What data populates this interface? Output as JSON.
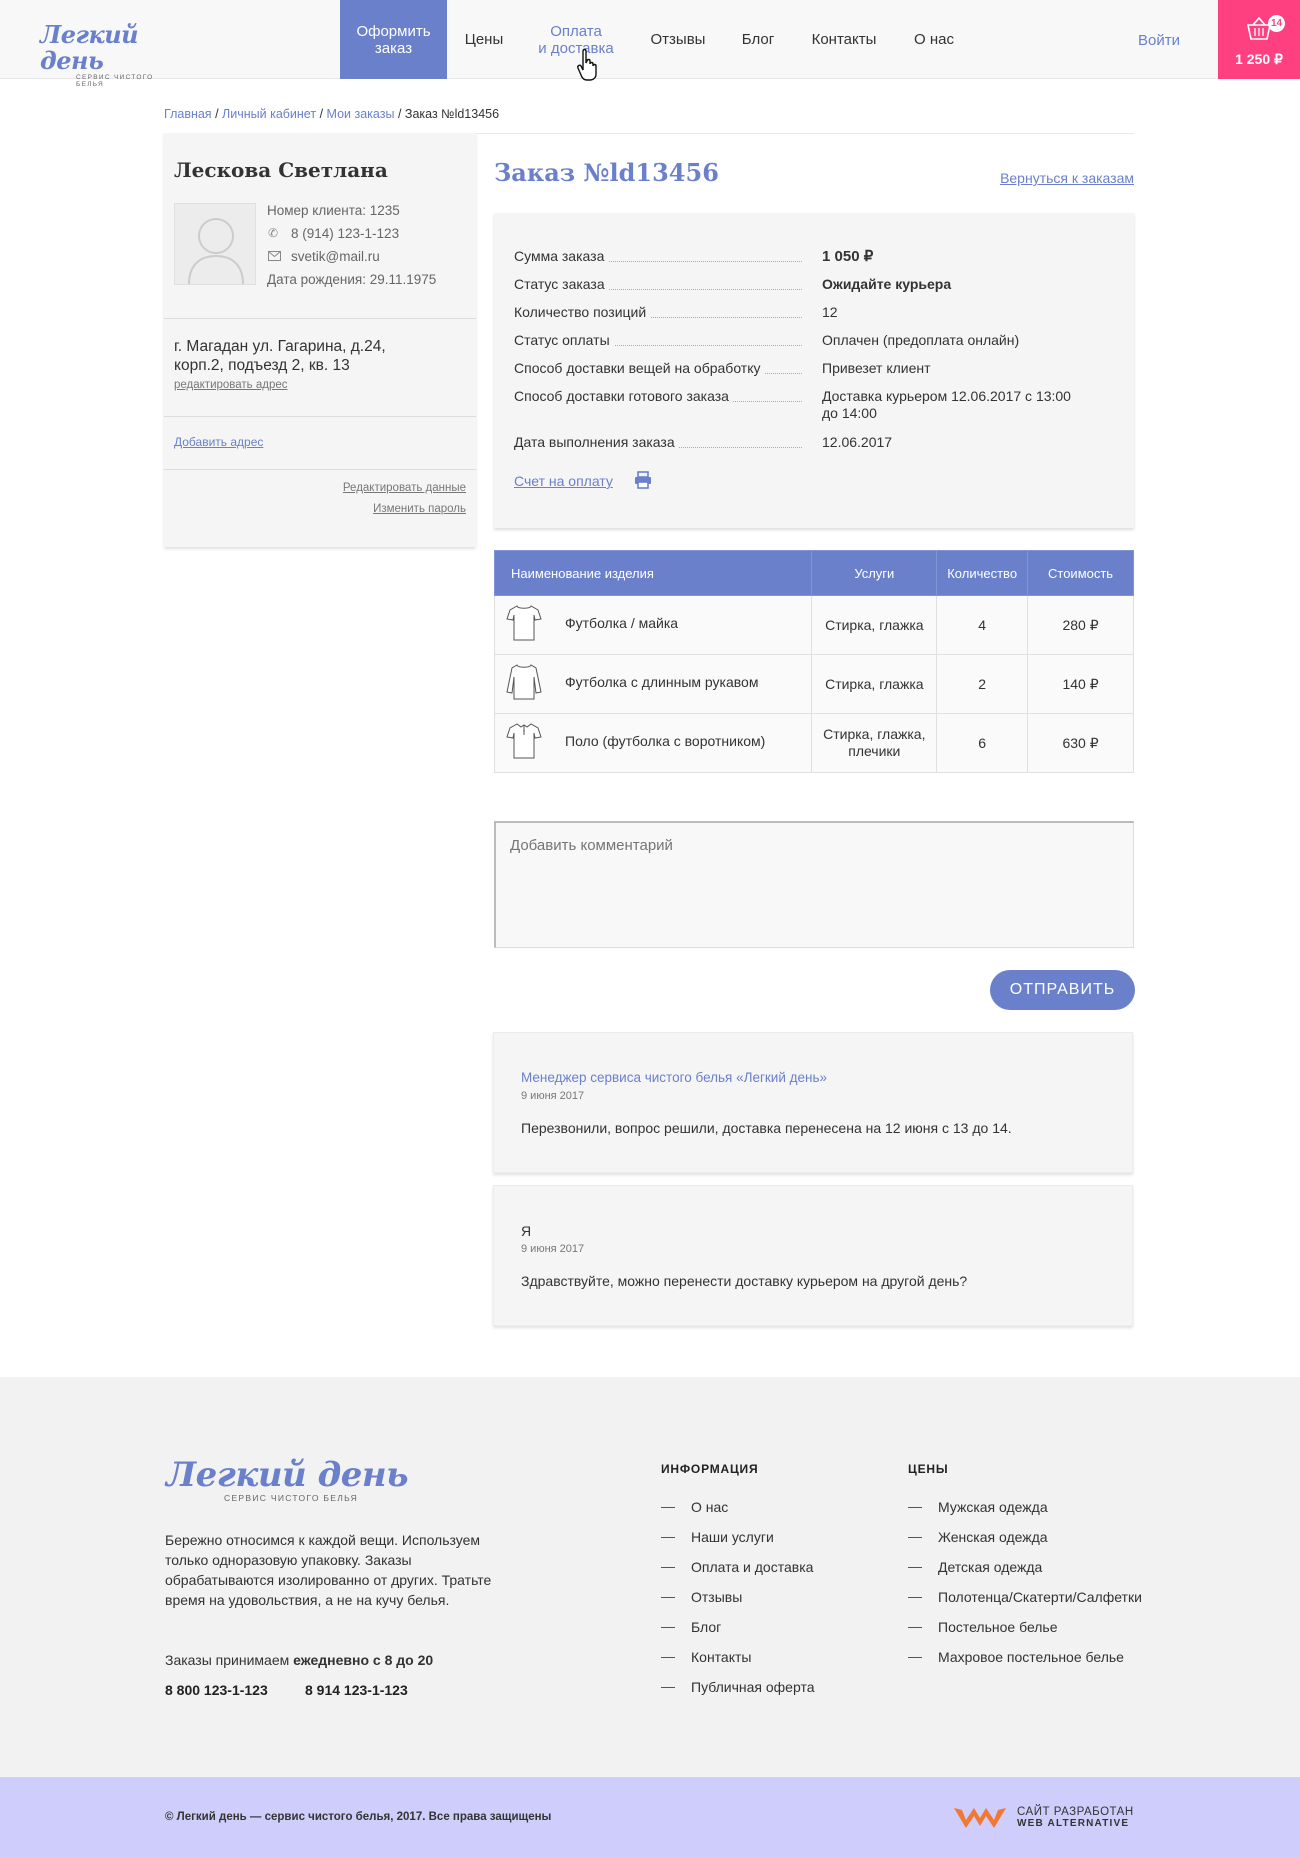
{
  "header": {
    "logo_title": "Легкий день",
    "logo_subtitle": "сервис чистого белья",
    "nav": [
      {
        "label_l1": "Оформить",
        "label_l2": "заказ"
      },
      {
        "label_l1": "Цены",
        "label_l2": ""
      },
      {
        "label_l1": "Оплата",
        "label_l2": "и доставка"
      },
      {
        "label_l1": "Отзывы",
        "label_l2": ""
      },
      {
        "label_l1": "Блог",
        "label_l2": ""
      },
      {
        "label_l1": "Контакты",
        "label_l2": ""
      },
      {
        "label_l1": "О нас",
        "label_l2": ""
      }
    ],
    "login": "Войти",
    "cart_count": "14",
    "cart_total": "1 250 ₽",
    "colors": {
      "accent": "#6a80cb",
      "cart": "#ff4080"
    }
  },
  "breadcrumb": {
    "home": "Главная",
    "cabinet": "Личный кабинет",
    "orders": "Мои заказы",
    "current": "Заказ №ld13456",
    "sep": "/"
  },
  "profile": {
    "name": "Лескова Светлана",
    "client_no": "Номер клиента: 1235",
    "phone": "8 (914) 123-1-123",
    "email": "svetik@mail.ru",
    "birthday": "Дата рождения: 29.11.1975",
    "address_l1": "г. Магадан ул. Гагарина, д.24,",
    "address_l2": "корп.2, подъезд 2, кв. 13",
    "edit_address": "редактировать адрес",
    "add_address": "Добавить адрес",
    "edit_data": "Редактировать данные",
    "change_password": "Изменить пароль"
  },
  "order": {
    "title": "Заказ №ld13456",
    "back_link": "Вернуться к заказам",
    "details": [
      {
        "label": "Сумма заказа",
        "value": "1 050 ₽",
        "value2": "",
        "bold": true
      },
      {
        "label": "Статус заказа",
        "value": "Ожидайте курьера",
        "value2": "",
        "bold": true
      },
      {
        "label": "Количество позиций",
        "value": "12",
        "value2": "",
        "bold": false
      },
      {
        "label": "Статус оплаты",
        "value": "Оплачен (предоплата онлайн)",
        "value2": "",
        "bold": false
      },
      {
        "label": "Способ доставки вещей на обработку",
        "value": "Привезет клиент",
        "value2": "",
        "bold": false
      },
      {
        "label": "Способ доставки готового заказа",
        "value": "Доставка курьером 12.06.2017 с 13:00",
        "value2": "до 14:00",
        "bold": false
      },
      {
        "label": "Дата выполнения заказа",
        "value": "12.06.2017",
        "value2": "",
        "bold": false
      }
    ],
    "invoice_link": "Счет на оплату"
  },
  "items_table": {
    "headers": [
      "Наименование изделия",
      "Услуги",
      "Количество",
      "Стоимость"
    ],
    "rows": [
      {
        "icon": "tshirt-icon",
        "name": "Футболка / майка",
        "services_l1": "Стирка, глажка",
        "services_l2": "",
        "qty": "4",
        "price": "280 ₽"
      },
      {
        "icon": "longsleeve-icon",
        "name": "Футболка с длинным рукавом",
        "services_l1": "Стирка, глажка",
        "services_l2": "",
        "qty": "2",
        "price": "140 ₽"
      },
      {
        "icon": "polo-icon",
        "name": "Поло (футболка с воротником)",
        "services_l1": "Стирка, глажка,",
        "services_l2": "плечики",
        "qty": "6",
        "price": "630 ₽"
      }
    ]
  },
  "comment": {
    "placeholder": "Добавить комментарий",
    "send": "ОТПРАВИТЬ"
  },
  "messages": [
    {
      "author": "Менеджер сервиса чистого белья «Легкий день»",
      "date": "9 июня 2017",
      "text": "Перезвонили, вопрос решили, доставка перенесена на 12 июня с 13 до 14."
    },
    {
      "author": "Я",
      "date": "9 июня 2017",
      "text": "Здравствуйте, можно перенести доставку курьером на другой день?"
    }
  ],
  "footer": {
    "about_l1": "Бережно относимся к каждой вещи. Используем",
    "about_l2": "только одноразовую упаковку.  Заказы",
    "about_l3": "обрабатываются изолированно от других. Тратьте",
    "about_l4": "время на удовольствия, а не на кучу белья.",
    "orders_prefix": "Заказы  принимаем",
    "orders_hours": "ежедневно с 8 до 20",
    "phone1": "8 800 123-1-123",
    "phone2": "8 914  123-1-123",
    "info_title": "ИНФОРМАЦИЯ",
    "info_links": [
      "О нас",
      "Наши услуги",
      "Оплата и доставка",
      "Отзывы",
      "Блог",
      "Контакты",
      "Публичная оферта"
    ],
    "prices_title": "ЦЕНЫ",
    "prices_links": [
      "Мужская одежда",
      "Женская одежда",
      "Детская одежда",
      "Полотенца/Скатерти/Салфетки",
      "Постельное белье",
      "Махровое постельное белье"
    ],
    "copyright": "© Легкий день — сервис чистого белья, 2017. Все права защищены",
    "dev_l1": "САЙТ РАЗРАБОТАН",
    "dev_l2": "WEB ALTERNATIVE"
  }
}
